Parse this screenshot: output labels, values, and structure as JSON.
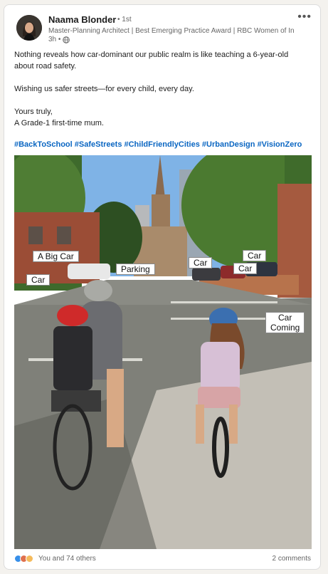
{
  "post": {
    "author": {
      "name": "Naama Blonder",
      "degree": "• 1st",
      "headline": "Master-Planning Architect | Best Emerging Practice Award | RBC Women of Inf...",
      "time": "3h •"
    },
    "menu_icon": "ellipsis-icon",
    "text": {
      "line1": "Nothing reveals how car-dominant our public realm is like teaching a 6-year-old",
      "line2": "about road safety.",
      "line3": "Wishing us safer streets—for every child, every day.",
      "line4": "Yours truly,",
      "line5": "A Grade-1 first-time mum."
    },
    "hashtags": [
      "#BackToSchool",
      "#SafeStreets",
      "#ChildFriendlyCities",
      "#UrbanDesign",
      "#VisionZero"
    ],
    "image_labels": {
      "big_car": "A Big Car",
      "car_left": "Car",
      "parking": "Parking",
      "car_center": "Car",
      "car_right_top": "Car",
      "car_right_bottom": "Car",
      "car_coming_line1": "Car",
      "car_coming_line2": "Coming"
    },
    "social": {
      "reactions_text": "You and 74 others",
      "comments_text": "2 comments"
    }
  },
  "colors": {
    "link": "#0a66c2",
    "like": "#378fe9",
    "love": "#df704d",
    "insight": "#f5bb5c"
  }
}
